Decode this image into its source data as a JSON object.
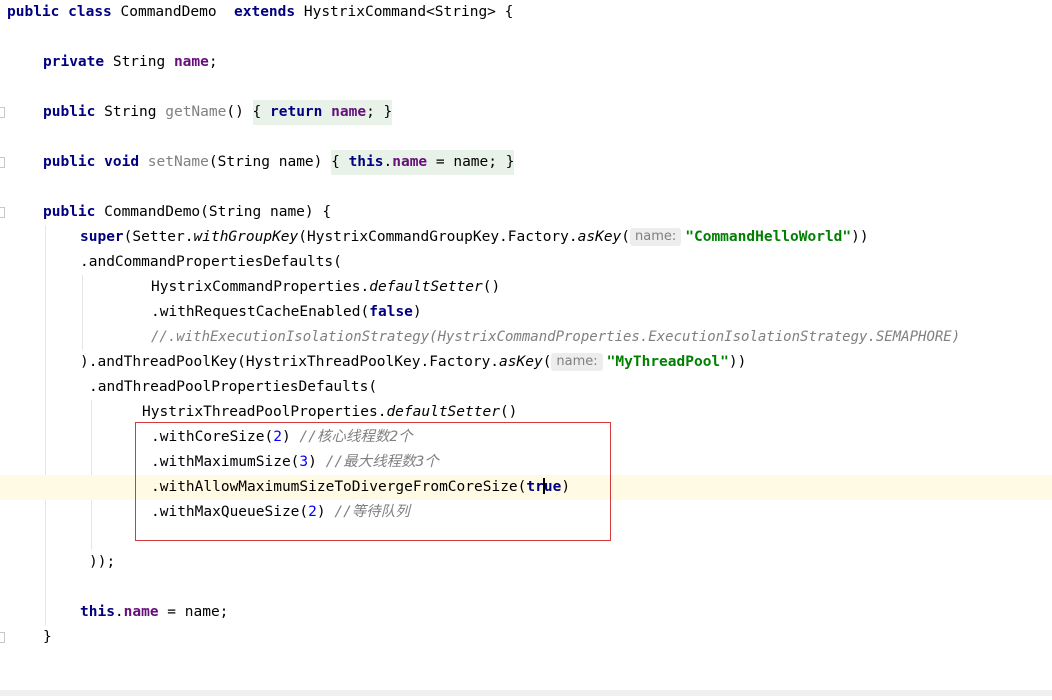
{
  "editor": {
    "class_decl": {
      "kw_public": "public",
      "kw_class": "class",
      "class_name": "CommandDemo",
      "kw_extends": "extends",
      "superclass": "HystrixCommand<String>",
      "brace": " {"
    },
    "field_decl": {
      "kw_private": "private",
      "type": " String ",
      "field": "name",
      "end": ";"
    },
    "getter": {
      "kw_public": "public",
      "type": " String ",
      "method": "getName",
      "params": "() ",
      "open": "{ ",
      "kw_return": "return",
      "space": " ",
      "field": "name",
      "end": "; }"
    },
    "setter": {
      "kw_public": "public",
      "space1": " ",
      "kw_void": "void",
      "space2": " ",
      "method": "setName",
      "params": "(String name) ",
      "open": "{ ",
      "kw_this": "this",
      "dot": ".",
      "field": "name",
      "rest": " = name; }"
    },
    "constructor": {
      "kw_public": "public",
      "decl": " CommandDemo(String name) {"
    },
    "super_line": {
      "kw_super": "super",
      "part1": "(Setter.",
      "with_group_key": "withGroupKey",
      "part2": "(HystrixCommandGroupKey.Factory.",
      "as_key": "asKey",
      "part3": "(",
      "hint": "name:",
      "value": "\"CommandHelloWorld\"",
      "part4": "))"
    },
    "and_command_props": ".andCommandPropertiesDefaults(",
    "command_props_setter": {
      "prefix": "HystrixCommandProperties.",
      "method": "defaultSetter",
      "suffix": "()"
    },
    "request_cache": {
      "prefix": ".withRequestCacheEnabled(",
      "kw_false": "false",
      "suffix": ")"
    },
    "isolation_comment": "//.withExecutionIsolationStrategy(HystrixCommandProperties.ExecutionIsolationStrategy.SEMAPHORE)",
    "thread_pool_key": {
      "prefix": ").andThreadPoolKey(HystrixThreadPoolKey.Factory.",
      "as_key": "asKey",
      "paren": "(",
      "hint": "name:",
      "value": "\"MyThreadPool\"",
      "suffix": "))"
    },
    "and_pool_props": ".andThreadPoolPropertiesDefaults(",
    "pool_props_setter": {
      "prefix": "HystrixThreadPoolProperties.",
      "method": "defaultSetter",
      "suffix": "()"
    },
    "core_size": {
      "prefix": ".withCoreSize(",
      "num": "2",
      "suffix": ") ",
      "comment": "//核心线程数2个"
    },
    "max_size": {
      "prefix": ".withMaximumSize(",
      "num": "3",
      "suffix": ") ",
      "comment": "//最大线程数3个"
    },
    "allow_diverge": {
      "prefix": ".withAllowMaximumSizeToDivergeFromCoreSize(",
      "kw_true_a": "tr",
      "kw_true_b": "ue",
      "suffix": ")"
    },
    "max_queue": {
      "prefix": ".withMaxQueueSize(",
      "num": "2",
      "suffix": ") ",
      "comment": "//等待队列"
    },
    "close_call": "));",
    "assign": {
      "kw_this": "this",
      "dot": ".",
      "field": "name",
      "rest": " = name;"
    },
    "close_brace": "}"
  },
  "colors": {
    "keyword": "#000080",
    "field": "#660e7a",
    "string": "#008000",
    "number": "#0000ff",
    "comment": "#808080",
    "current_line": "#fffae3",
    "highlight_box": "#d53a3a"
  }
}
